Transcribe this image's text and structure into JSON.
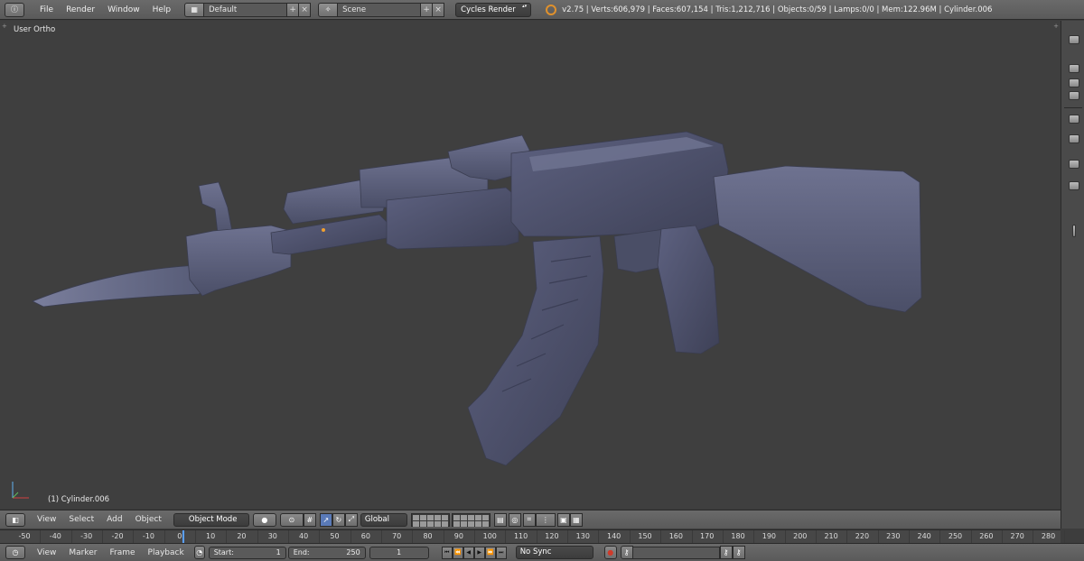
{
  "top_bar": {
    "menus": [
      "File",
      "Render",
      "Window",
      "Help"
    ],
    "screen_layout": "Default",
    "scene": "Scene",
    "render_engine": "Cycles Render",
    "stats": "v2.75 | Verts:606,979 | Faces:607,154 | Tris:1,212,716 | Objects:0/59 | Lamps:0/0 | Mem:122.96M | Cylinder.006"
  },
  "viewport": {
    "view_name": "User Ortho",
    "active_object": "(1) Cylinder.006",
    "background_color": "#3f3f3f",
    "mesh_color": "#5c6078"
  },
  "view_header": {
    "menus": [
      "View",
      "Select",
      "Add",
      "Object"
    ],
    "mode": "Object Mode",
    "transform_orientation": "Global"
  },
  "timeline": {
    "ticks": [
      "-50",
      "-40",
      "-30",
      "-20",
      "-10",
      "0",
      "10",
      "20",
      "30",
      "40",
      "50",
      "60",
      "70",
      "80",
      "90",
      "100",
      "110",
      "120",
      "130",
      "140",
      "150",
      "160",
      "170",
      "180",
      "190",
      "200",
      "210",
      "220",
      "230",
      "240",
      "250",
      "260",
      "270",
      "280"
    ],
    "current_frame": 1
  },
  "timeline_header": {
    "menus": [
      "View",
      "Marker",
      "Frame",
      "Playback"
    ],
    "start_label": "Start:",
    "start_value": "1",
    "end_label": "End:",
    "end_value": "250",
    "current_frame": "1",
    "sync": "No Sync"
  },
  "colors": {
    "header_bg": "#5f5f5f",
    "accent_blue": "#5a9fff",
    "record_red": "#d03a2a"
  }
}
